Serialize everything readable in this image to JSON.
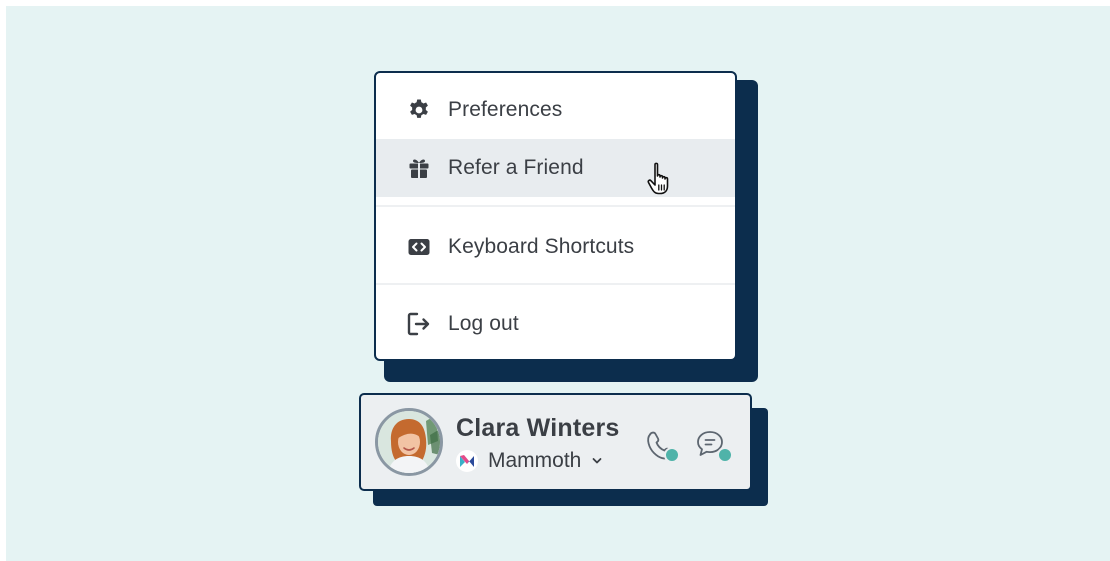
{
  "menu": {
    "items": [
      {
        "label": "Preferences",
        "icon": "gear-icon"
      },
      {
        "label": "Refer a Friend",
        "icon": "gift-icon"
      },
      {
        "label": "Keyboard Shortcuts",
        "icon": "code-brackets-icon"
      },
      {
        "label": "Log out",
        "icon": "logout-icon"
      }
    ]
  },
  "user": {
    "name": "Clara Winters",
    "organization": "Mammoth"
  },
  "colors": {
    "background": "#e5f3f3",
    "navy": "#0c2d4d",
    "hover": "#e8ecef",
    "status_online": "#4fb3a9"
  }
}
